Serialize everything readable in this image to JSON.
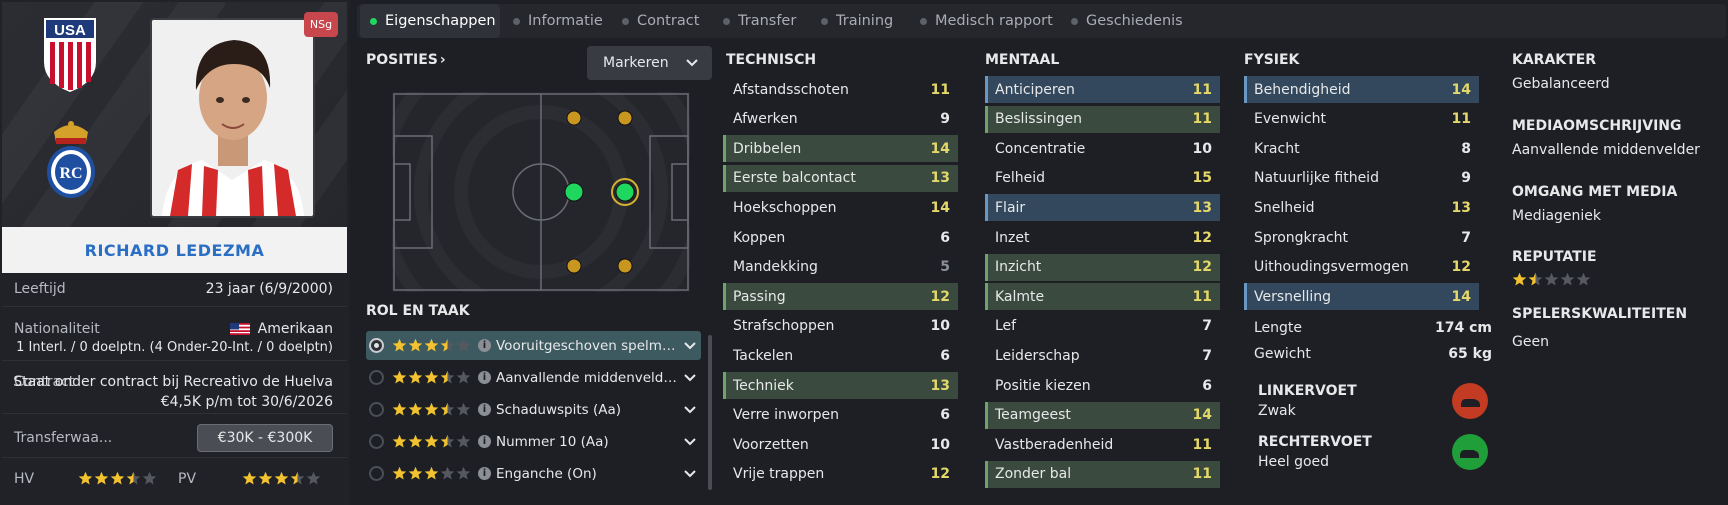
{
  "player": {
    "name": "RICHARD LEDEZMA",
    "badge": "NSg",
    "nat_badge_text": "USA"
  },
  "details": {
    "age_label": "Leeftijd",
    "age_value": "23 jaar (6/9/2000)",
    "nationality_label": "Nationaliteit",
    "nationality_value": "Amerikaan",
    "caps_line": "1 Interl. / 0 doelptn. (4 Onder-20-Int. / 0 doelptn)",
    "contract_label": "Contract",
    "contract_line1": "Staat onder contract bij Recreativo de Huelva",
    "contract_line2": "€4,5K p/m tot 30/6/2026",
    "transfer_label": "Transferwaa...",
    "transfer_value": "€30K - €300K",
    "ca_label": "HV",
    "pa_label": "PV",
    "ca_stars": 3.5,
    "pa_stars": 3.5
  },
  "tabs": [
    {
      "label": "Eigenschappen",
      "active": true
    },
    {
      "label": "Informatie"
    },
    {
      "label": "Contract"
    },
    {
      "label": "Transfer"
    },
    {
      "label": "Training"
    },
    {
      "label": "Medisch rapport"
    },
    {
      "label": "Geschiedenis"
    }
  ],
  "positions": {
    "title": "POSITIES",
    "mark_button": "Markeren"
  },
  "roles": {
    "title": "ROL EN TAAK",
    "items": [
      {
        "label": "Vooruitgeschoven spelma...",
        "stars": 3.5,
        "selected": true
      },
      {
        "label": "Aanvallende middenvelder...",
        "stars": 3.5
      },
      {
        "label": "Schaduwspits (Aa)",
        "stars": 3.5
      },
      {
        "label": "Nummer 10 (Aa)",
        "stars": 3.5
      },
      {
        "label": "Enganche (On)",
        "stars": 3
      }
    ]
  },
  "technical": {
    "title": "TECHNISCH",
    "attrs": [
      {
        "name": "Afstandsschoten",
        "value": 11
      },
      {
        "name": "Afwerken",
        "value": 9
      },
      {
        "name": "Dribbelen",
        "value": 14,
        "hl": "g"
      },
      {
        "name": "Eerste balcontact",
        "value": 13,
        "hl": "g"
      },
      {
        "name": "Hoekschoppen",
        "value": 14
      },
      {
        "name": "Koppen",
        "value": 6
      },
      {
        "name": "Mandekking",
        "value": 5
      },
      {
        "name": "Passing",
        "value": 12,
        "hl": "g"
      },
      {
        "name": "Strafschoppen",
        "value": 10
      },
      {
        "name": "Tackelen",
        "value": 6
      },
      {
        "name": "Techniek",
        "value": 13,
        "hl": "g"
      },
      {
        "name": "Verre inworpen",
        "value": 6
      },
      {
        "name": "Voorzetten",
        "value": 10
      },
      {
        "name": "Vrije trappen",
        "value": 12
      }
    ]
  },
  "mental": {
    "title": "MENTAAL",
    "attrs": [
      {
        "name": "Anticiperen",
        "value": 11,
        "hl": "b"
      },
      {
        "name": "Beslissingen",
        "value": 11,
        "hl": "g"
      },
      {
        "name": "Concentratie",
        "value": 10
      },
      {
        "name": "Felheid",
        "value": 15
      },
      {
        "name": "Flair",
        "value": 13,
        "hl": "b"
      },
      {
        "name": "Inzet",
        "value": 12
      },
      {
        "name": "Inzicht",
        "value": 12,
        "hl": "g"
      },
      {
        "name": "Kalmte",
        "value": 11,
        "hl": "g"
      },
      {
        "name": "Lef",
        "value": 7
      },
      {
        "name": "Leiderschap",
        "value": 7
      },
      {
        "name": "Positie kiezen",
        "value": 6
      },
      {
        "name": "Teamgeest",
        "value": 14,
        "hl": "g"
      },
      {
        "name": "Vastberadenheid",
        "value": 11
      },
      {
        "name": "Zonder bal",
        "value": 11,
        "hl": "g"
      }
    ]
  },
  "physical": {
    "title": "FYSIEK",
    "attrs": [
      {
        "name": "Behendigheid",
        "value": 14,
        "hl": "b"
      },
      {
        "name": "Evenwicht",
        "value": 11
      },
      {
        "name": "Kracht",
        "value": 8
      },
      {
        "name": "Natuurlijke fitheid",
        "value": 9
      },
      {
        "name": "Snelheid",
        "value": 13
      },
      {
        "name": "Sprongkracht",
        "value": 7
      },
      {
        "name": "Uithoudingsvermogen",
        "value": 12
      },
      {
        "name": "Versnelling",
        "value": 14,
        "hl": "b"
      }
    ],
    "height_label": "Lengte",
    "height_value": "174 cm",
    "weight_label": "Gewicht",
    "weight_value": "65 kg",
    "left_foot_label": "LINKERVOET",
    "left_foot_value": "Zwak",
    "right_foot_label": "RECHTERVOET",
    "right_foot_value": "Heel goed",
    "left_foot_color": "#c23b22",
    "right_foot_color": "#1f9e3a"
  },
  "personality": {
    "character_label": "KARAKTER",
    "character_value": "Gebalanceerd",
    "media_label": "MEDIAOMSCHRIJVING",
    "media_value": "Aanvallende middenvelder",
    "media_handling_label": "OMGANG MET MEDIA",
    "media_handling_value": "Mediageniek",
    "reputation_label": "REPUTATIE",
    "reputation_stars": 1.5,
    "traits_label": "SPELERSKWALITEITEN",
    "traits_value": "Geen"
  },
  "colors": {
    "accent_green": "#1fd65f",
    "star": "#f2c230",
    "value_high": "#e5d86a"
  }
}
